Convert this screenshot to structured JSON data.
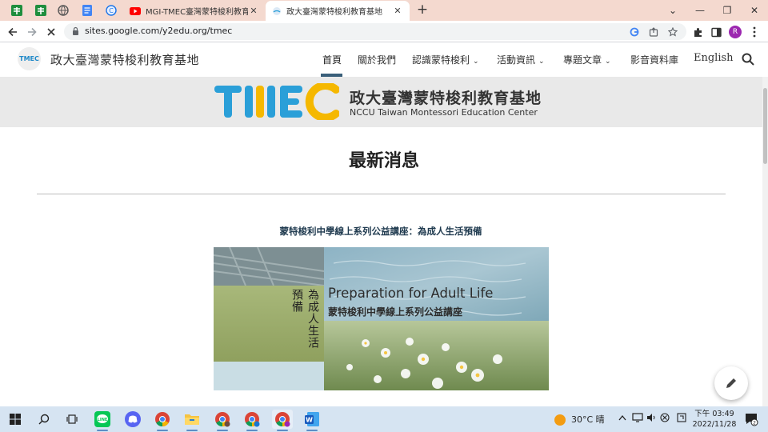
{
  "browser": {
    "tabs": [
      {
        "title": "MGI-TMEC臺灣蒙特梭利教育基",
        "close": "✕",
        "active": false
      },
      {
        "title": "政大臺灣蒙特梭利教育基地",
        "close": "✕",
        "active": true
      }
    ],
    "new_tab": "+",
    "window_controls": {
      "chevron": "⌄",
      "minimize": "—",
      "restore": "❐",
      "close": "✕"
    },
    "url": "sites.google.com/y2edu.org/tmec",
    "profile_initial": "R"
  },
  "site": {
    "logo_text": "TMEC",
    "name": "政大臺灣蒙特梭利教育基地",
    "nav": [
      {
        "label": "首頁",
        "dropdown": false,
        "active": true
      },
      {
        "label": "關於我們",
        "dropdown": false
      },
      {
        "label": "認識蒙特梭利",
        "dropdown": true
      },
      {
        "label": "活動資訊",
        "dropdown": true
      },
      {
        "label": "專題文章",
        "dropdown": true
      },
      {
        "label": "影音資料庫",
        "dropdown": false
      },
      {
        "label": "English",
        "dropdown": false
      }
    ],
    "nav_chevron": "⌄"
  },
  "banner": {
    "title_zh": "政大臺灣蒙特梭利教育基地",
    "title_en": "NCCU Taiwan Montessori Education Center",
    "logo_colors": [
      "#2a9fd8",
      "#2a9fd8",
      "#f5b800",
      "#2a9fd8",
      "#f5b800"
    ]
  },
  "main": {
    "heading": "最新消息",
    "news_title": "蒙特梭利中學線上系列公益講座：為成人生活預備",
    "hero": {
      "en": "Preparation for Adult Life",
      "zh": "蒙特梭利中學線上系列公益講座",
      "vertical_1": "為成人生活",
      "vertical_2": "預備"
    }
  },
  "taskbar": {
    "weather": "30°C 晴",
    "time": "下午 03:49",
    "date": "2022/11/28",
    "notification_count": "2"
  },
  "colors": {
    "tab_strip": "#f4d9cf",
    "taskbar": "#d6e4f2",
    "nav_active_underline": "#3a5f7a",
    "tmec_blue": "#2a9fd8",
    "tmec_yellow": "#f5b800"
  }
}
